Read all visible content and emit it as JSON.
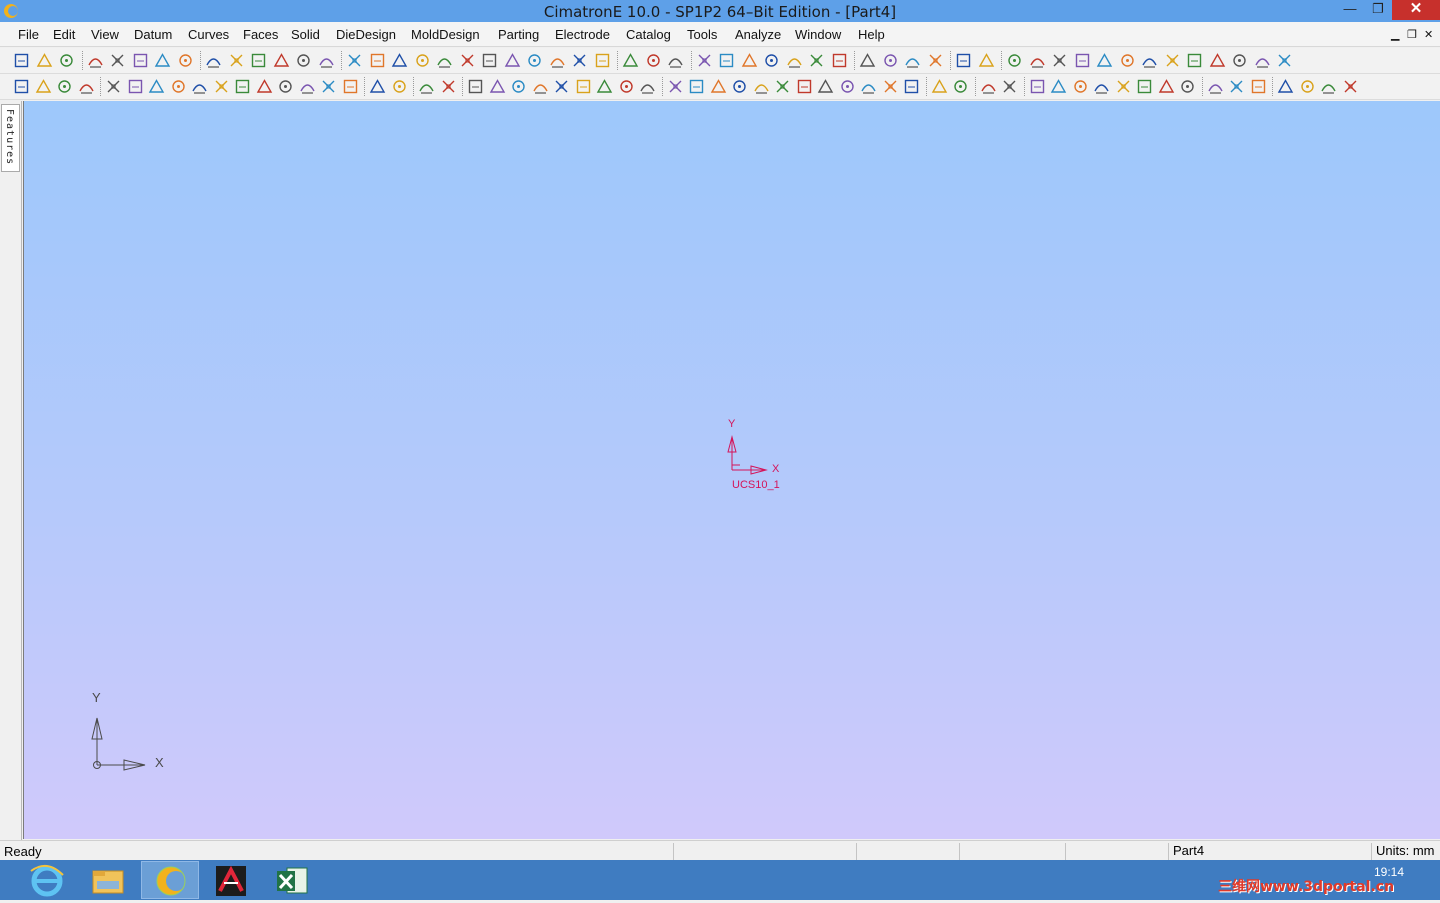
{
  "window": {
    "title": "CimatronE 10.0 - SP1P2 64–Bit Edition - [Part4]",
    "minimize_glyph": "—",
    "restore_glyph": "❐",
    "close_glyph": "✕"
  },
  "menu": {
    "items": [
      "File",
      "Edit",
      "View",
      "Datum",
      "Curves",
      "Faces",
      "Solid",
      "DieDesign",
      "MoldDesign",
      "Parting",
      "Electrode",
      "Catalog",
      "Tools",
      "Analyze",
      "Window",
      "Help"
    ],
    "mdi_min": "▁",
    "mdi_restore": "❐",
    "mdi_close": "✕"
  },
  "side_panel": {
    "features_tab": "Features"
  },
  "viewport": {
    "ucs_name": "UCS10_1",
    "ucs_x_label": "X",
    "ucs_y_label": "Y",
    "triad_x_label": "X",
    "triad_y_label": "Y",
    "ucs_color": "#d4145a",
    "triad_color": "#4a4a4a"
  },
  "status": {
    "ready": "Ready",
    "part": "Part4",
    "units": "Units: mm"
  },
  "taskbar": {
    "apps": [
      "internet-explorer",
      "file-explorer",
      "cimatron",
      "autocad",
      "excel"
    ],
    "active": "cimatron",
    "time": "19:14",
    "watermark": "三维网www.3dportal.cn"
  },
  "toolbar1": {
    "icons": [
      "new-file-icon",
      "open-file-icon",
      "save-icon",
      "undo-icon",
      "redo-icon",
      "glasses-icon",
      "layer-manager-icon",
      "multi-view-icon",
      "zoom-all-icon",
      "zoom-window-icon",
      "zoom-previous-icon",
      "zoom-icon",
      "pan-icon",
      "rotate-icon",
      "iso-view-icon",
      "front-view-icon",
      "back-view-icon",
      "top-view-icon",
      "bottom-view-icon",
      "left-view-icon",
      "right-view-icon",
      "view-options-icon",
      "shaded-icon",
      "wireframe-icon",
      "hidden-line-icon",
      "display-mode-icon",
      "light-bulb-icon",
      "light-on-icon",
      "light-off-icon",
      "prev-icon",
      "next-icon",
      "tree-icon",
      "measure-icon",
      "explode-icon",
      "copy-icon",
      "paste-icon",
      "grid-icon",
      "color-fill-icon",
      "pencil-icon",
      "line-style-icon",
      "line-weight-icon",
      "cube-icon",
      "sketch-line-icon",
      "sketch-arc-icon",
      "sketch-circle-icon",
      "sketch-spline-icon",
      "sketch-rect-icon",
      "sketch-trim-icon",
      "sketch-dim-icon",
      "sketch-constraint-icon",
      "sketch-corner-icon",
      "sketch-select-icon",
      "sketch-mirror-icon",
      "sketch-text-icon",
      "sketch-tool-icon"
    ]
  },
  "toolbar2": {
    "icons": [
      "delete-selection-icon",
      "cancel-icon",
      "select-box-icon",
      "filter-icon",
      "pick-entity-icon",
      "select-curve-icon",
      "select-face-icon",
      "select-solid-icon",
      "select-edge-icon",
      "select-point-icon",
      "select-loop-icon",
      "select-chain-icon",
      "select-all-icon",
      "select-similar-icon",
      "select-list-icon",
      "layer-select-icon",
      "hide-icon",
      "show-icon",
      "sketch-icon",
      "face-sketch-icon",
      "point-icon",
      "line-icon",
      "spline-icon",
      "circle-icon",
      "composite-curve-icon",
      "offset-curve-icon",
      "project-curve-icon",
      "intersect-curve-icon",
      "trim-curve-icon",
      "extrude-icon",
      "revolve-icon",
      "sweep-icon",
      "loft-icon",
      "blend-icon",
      "fillet-icon",
      "chamfer-icon",
      "shell-icon",
      "draft-icon",
      "split-icon",
      "cut-icon",
      "boolean-add-icon",
      "boolean-remove-icon",
      "pattern-icon",
      "mirror-icon",
      "scale-icon",
      "move-icon",
      "rotate-body-icon",
      "copy-body-icon",
      "stitch-icon",
      "fill-icon",
      "extend-icon",
      "offset-face-icon",
      "replace-face-icon",
      "delete-face-icon",
      "bounding-box-icon",
      "electrode-icon",
      "mold-base-icon",
      "insert-icon",
      "part-icon",
      "assembly-icon"
    ]
  }
}
